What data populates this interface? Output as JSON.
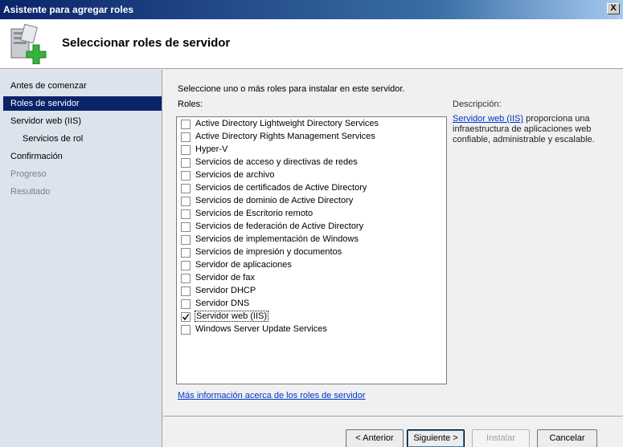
{
  "window": {
    "title": "Asistente para agregar roles",
    "close_label": "X"
  },
  "header": {
    "title": "Seleccionar roles de servidor"
  },
  "sidebar": {
    "items": [
      {
        "label": "Antes de comenzar"
      },
      {
        "label": "Roles de servidor"
      },
      {
        "label": "Servidor web (IIS)"
      },
      {
        "label": "Servicios de rol"
      },
      {
        "label": "Confirmación"
      },
      {
        "label": "Progreso"
      },
      {
        "label": "Resultado"
      }
    ]
  },
  "main": {
    "instruction": "Seleccione uno o más roles para instalar en este servidor.",
    "roles_label": "Roles:",
    "roles": [
      {
        "label": "Active Directory Lightweight Directory Services",
        "checked": false
      },
      {
        "label": "Active Directory Rights Management Services",
        "checked": false
      },
      {
        "label": "Hyper-V",
        "checked": false
      },
      {
        "label": "Servicios de acceso y directivas de redes",
        "checked": false
      },
      {
        "label": "Servicios de archivo",
        "checked": false
      },
      {
        "label": "Servicios de certificados de Active Directory",
        "checked": false
      },
      {
        "label": "Servicios de dominio de Active Directory",
        "checked": false
      },
      {
        "label": "Servicios de Escritorio remoto",
        "checked": false
      },
      {
        "label": "Servicios de federación de Active Directory",
        "checked": false
      },
      {
        "label": "Servicios de implementación de Windows",
        "checked": false
      },
      {
        "label": "Servicios de impresión y documentos",
        "checked": false
      },
      {
        "label": "Servidor de aplicaciones",
        "checked": false
      },
      {
        "label": "Servidor de fax",
        "checked": false
      },
      {
        "label": "Servidor DHCP",
        "checked": false
      },
      {
        "label": "Servidor DNS",
        "checked": false
      },
      {
        "label": "Servidor web (IIS)",
        "checked": true
      },
      {
        "label": "Windows Server Update Services",
        "checked": false
      }
    ],
    "description_title": "Descripción:",
    "description_link": "Servidor web (IIS)",
    "description_text": " proporciona una infraestructura de aplicaciones web confiable, administrable y escalable.",
    "more_info_link": "Más información acerca de los roles de servidor"
  },
  "footer": {
    "back_label": "< Anterior",
    "next_label": "Siguiente >",
    "install_label": "Instalar",
    "cancel_label": "Cancelar"
  }
}
